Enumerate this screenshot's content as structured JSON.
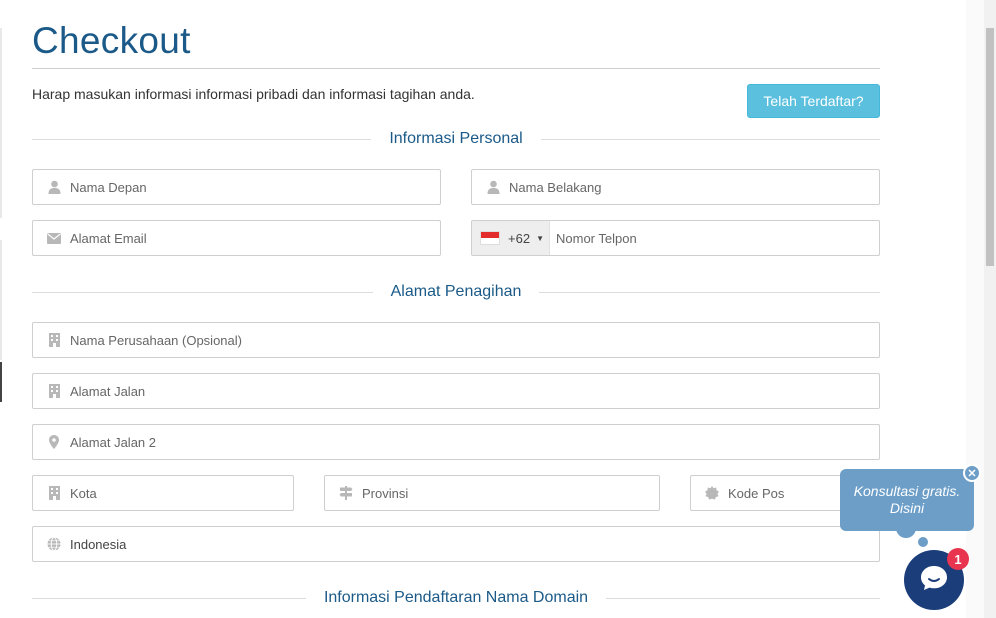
{
  "page": {
    "title": "Checkout",
    "intro": "Harap masukan informasi informasi pribadi dan informasi tagihan anda.",
    "already_registered_button": "Telah Terdaftar?"
  },
  "sections": {
    "personal": "Informasi Personal",
    "billing": "Alamat Penagihan",
    "domain": "Informasi Pendaftaran Nama Domain"
  },
  "fields": {
    "first_name": "Nama Depan",
    "last_name": "Nama Belakang",
    "email": "Alamat Email",
    "phone_code": "+62",
    "phone": "Nomor Telpon",
    "company": "Nama Perusahaan (Opsional)",
    "address1": "Alamat Jalan",
    "address2": "Alamat Jalan 2",
    "city": "Kota",
    "state": "Provinsi",
    "postcode": "Kode Pos",
    "country": "Indonesia"
  },
  "chat": {
    "bubble_text": "Konsultasi gratis. Disini",
    "badge_count": "1"
  },
  "colors": {
    "heading": "#1b5a88",
    "info_button": "#5bc0de",
    "chat_bubble": "#6c9ec8",
    "chat_button": "#1b3e7a",
    "badge": "#e8344e",
    "icon": "#b8b8b8"
  },
  "icons": {
    "first_name": "user-icon",
    "last_name": "user-icon",
    "email": "envelope-icon",
    "company": "building-icon",
    "address1": "building-icon",
    "address2": "map-marker-icon",
    "city": "building-icon",
    "state": "signpost-icon",
    "postcode": "certificate-icon",
    "country": "globe-icon"
  }
}
